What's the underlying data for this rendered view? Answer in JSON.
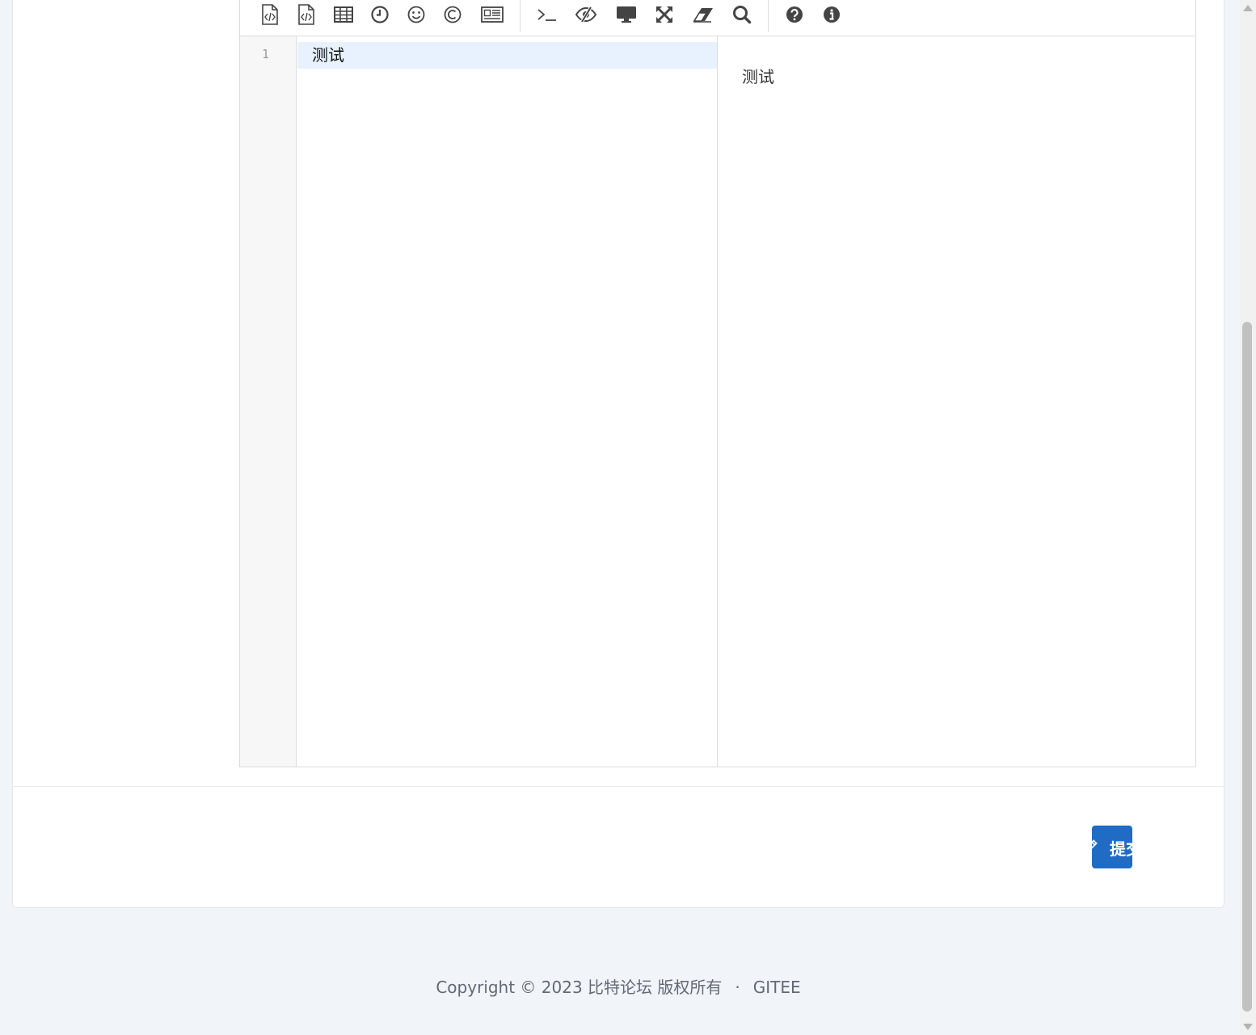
{
  "editor": {
    "toolbar": {
      "buttons": [
        {
          "name": "html-entities-icon"
        },
        {
          "name": "code-file-icon"
        },
        {
          "name": "table-icon"
        },
        {
          "name": "datetime-icon"
        },
        {
          "name": "emoji-icon"
        },
        {
          "name": "html-entity-copyright-icon"
        },
        {
          "name": "pagebreak-icon"
        },
        {
          "name": "goto-line-icon"
        },
        {
          "name": "toggle-preview-icon"
        },
        {
          "name": "watch-preview-icon"
        },
        {
          "name": "fullscreen-icon"
        },
        {
          "name": "clear-icon"
        },
        {
          "name": "search-icon"
        },
        {
          "name": "help-icon"
        },
        {
          "name": "info-icon"
        }
      ]
    },
    "line_number": "1",
    "code": "测试",
    "preview": "测试"
  },
  "submit": {
    "label": "提交",
    "icon": "pen-icon",
    "color": "#206bc4"
  },
  "footer": {
    "copyright": "Copyright © 2023 比特论坛 版权所有",
    "separator": "·",
    "link": "GITEE"
  }
}
